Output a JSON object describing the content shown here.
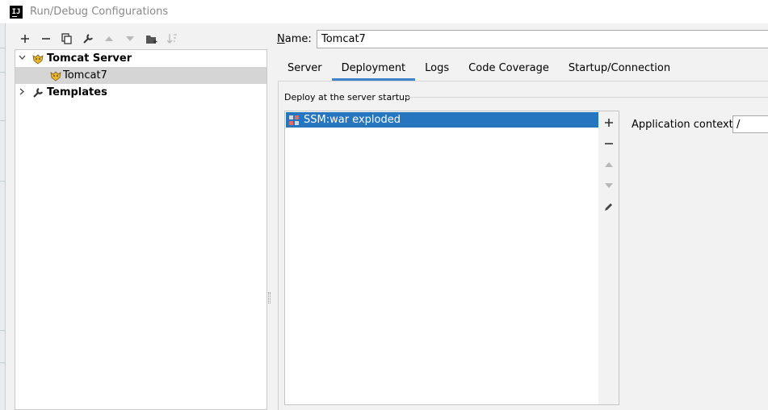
{
  "window": {
    "title": "Run/Debug Configurations",
    "logo_text": "IJ"
  },
  "toolbar": {
    "buttons": [
      {
        "icon": "plus-icon",
        "enabled": true
      },
      {
        "icon": "minus-icon",
        "enabled": true
      },
      {
        "icon": "copy-icon",
        "enabled": true
      },
      {
        "icon": "wrench-icon",
        "enabled": true
      },
      {
        "icon": "move-up-icon",
        "enabled": false
      },
      {
        "icon": "move-down-icon",
        "enabled": false
      },
      {
        "icon": "folder-icon",
        "enabled": true
      },
      {
        "icon": "sort-icon",
        "enabled": false
      }
    ]
  },
  "tree": {
    "items": [
      {
        "label": "Tomcat Server",
        "expanded": true,
        "bold": true
      },
      {
        "label": "Tomcat7",
        "selected": true
      },
      {
        "label": "Templates",
        "expanded": false,
        "bold": true
      }
    ]
  },
  "name_field": {
    "label_prefix": "N",
    "label_rest": "ame:",
    "value": "Tomcat7"
  },
  "tabs": [
    {
      "label": "Server",
      "active": false
    },
    {
      "label": "Deployment",
      "active": true
    },
    {
      "label": "Logs",
      "active": false
    },
    {
      "label": "Code Coverage",
      "active": false
    },
    {
      "label": "Startup/Connection",
      "active": false
    }
  ],
  "deployment": {
    "group_title": "Deploy at the server startup",
    "artifacts": [
      {
        "label": "SSM:war exploded",
        "selected": true
      }
    ],
    "side_buttons": [
      {
        "icon": "plus-icon",
        "enabled": true
      },
      {
        "icon": "minus-icon",
        "enabled": true
      },
      {
        "icon": "move-up-icon",
        "enabled": false
      },
      {
        "icon": "move-down-icon",
        "enabled": false
      },
      {
        "icon": "pencil-icon",
        "enabled": true
      }
    ],
    "context_label": "Application context:",
    "context_value": "/"
  },
  "colors": {
    "selection": "#2675bf",
    "tab_underline": "#4083c9",
    "tree_selected": "#d5d5d5"
  }
}
